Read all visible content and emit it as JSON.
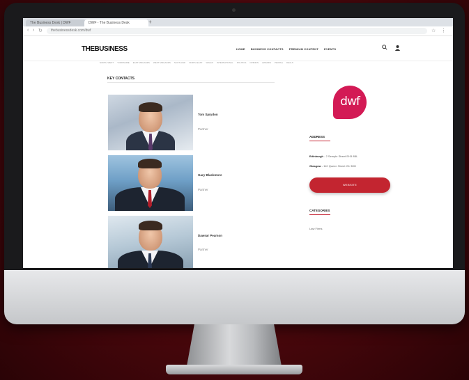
{
  "browser": {
    "tabs": [
      {
        "label": "The Business Desk | DWF"
      },
      {
        "label": "DWF - The Business Desk"
      }
    ],
    "new_tab": "+",
    "url": "thebusinessdesk.com/dwf",
    "back": "‹",
    "forward": "›",
    "reload": "↻",
    "menu": "⋮"
  },
  "site": {
    "logo": "THEBUSINESS",
    "nav": [
      "HOME",
      "BUSINESS CONTACTS",
      "PREMIUM CONTENT",
      "EVENTS"
    ],
    "subnav": [
      "NORTH WEST",
      "YORKSHIRE",
      "EAST MIDLANDS",
      "WEST MIDLANDS",
      "SCOTLAND",
      "NORTH EAST",
      "WALES",
      "INTERNATIONAL",
      "POLITICS",
      "OPINION",
      "AWARDS",
      "PEOPLE",
      "DEALS"
    ],
    "search_icon": "search-icon",
    "account_icon": "user-icon"
  },
  "main": {
    "section_title": "KEY CONTACTS",
    "people": [
      {
        "name": "Tom Sprydon",
        "role": "Partner"
      },
      {
        "name": "Gary Blackmore",
        "role": "Partner"
      },
      {
        "name": "Dawsar Pearson",
        "role": "Partner"
      }
    ]
  },
  "sidebar": {
    "brand_logo": "dwf",
    "address_heading": "ADDRESS",
    "addresses": [
      {
        "label": "Edinburgh",
        "value": "2 Semple Street EH3 8BL"
      },
      {
        "label": "Glasgow",
        "value": "110 Queen Street G1 3HD"
      }
    ],
    "website_button": "WEBSITE",
    "categories_heading": "CATEGORIES",
    "categories": [
      "Law Firms"
    ]
  },
  "colors": {
    "brand_red": "#c32530",
    "dwf_pink": "#d31a55",
    "background": "#5a0a10"
  }
}
